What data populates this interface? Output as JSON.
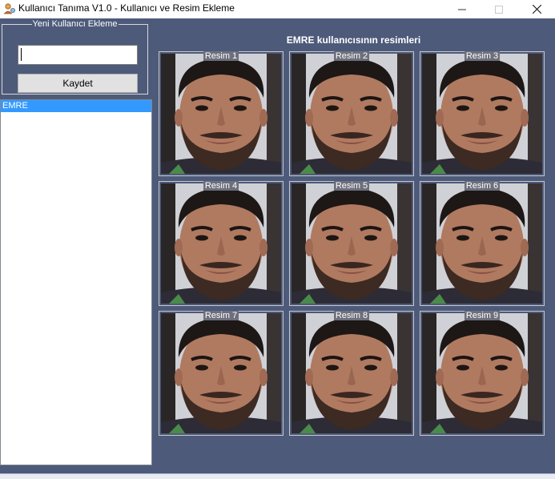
{
  "window": {
    "title": "Kullanıcı Tanıma V1.0 - Kullanıcı ve Resim Ekleme"
  },
  "new_user": {
    "group_title": "Yeni Kullanıcı Ekleme",
    "name_value": "",
    "save_label": "Kaydet"
  },
  "users": {
    "items": [
      "EMRE"
    ],
    "selected": "EMRE"
  },
  "gallery": {
    "title": "EMRE kullanıcısının resimleri",
    "images": [
      {
        "label": "Resim 1"
      },
      {
        "label": "Resim 2"
      },
      {
        "label": "Resim 3"
      },
      {
        "label": "Resim 4"
      },
      {
        "label": "Resim 5"
      },
      {
        "label": "Resim 6"
      },
      {
        "label": "Resim 7"
      },
      {
        "label": "Resim 8"
      },
      {
        "label": "Resim 9"
      }
    ]
  },
  "colors": {
    "client_bg": "#4d5a7a",
    "selection": "#3399ff"
  }
}
